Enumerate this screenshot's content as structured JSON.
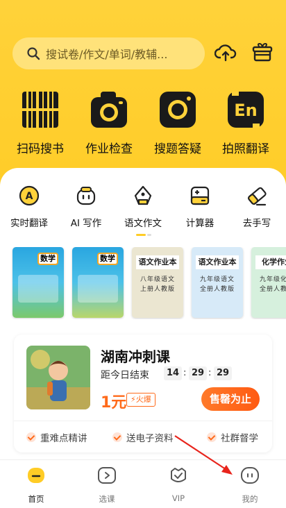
{
  "search": {
    "placeholder": "搜试卷/作文/单词/教辅..."
  },
  "header_icons": [
    "upload-cloud-icon",
    "gift-icon"
  ],
  "features": [
    {
      "label": "扫码搜书",
      "icon": "barcode-icon"
    },
    {
      "label": "作业检查",
      "icon": "camera-icon"
    },
    {
      "label": "搜题答疑",
      "icon": "photo-search-icon"
    },
    {
      "label": "拍照翻译",
      "icon": "translate-en-icon"
    }
  ],
  "tools": [
    {
      "label": "实时翻译",
      "icon": "translate-a-icon"
    },
    {
      "label": "AI 写作",
      "icon": "robot-icon"
    },
    {
      "label": "语文作文",
      "icon": "pen-nib-icon"
    },
    {
      "label": "计算器",
      "icon": "calculator-icon"
    },
    {
      "label": "去手写",
      "icon": "eraser-icon"
    }
  ],
  "books": [
    {
      "badge": "数学",
      "caption": "",
      "color": "#2b9ad8"
    },
    {
      "badge": "数学",
      "caption": "",
      "color": "#2b9ad8"
    },
    {
      "badge": "语文作业本",
      "caption": "八年级语文 上册人教版",
      "color": "#e9e4cf"
    },
    {
      "badge": "语文作业本",
      "caption": "九年级语文 全册人教版",
      "color": "#d9ebf7"
    },
    {
      "badge": "化学作业",
      "caption": "九年级化学 全册人教版",
      "color": "#d8f0df"
    }
  ],
  "promo": {
    "title": "湖南冲刺课",
    "countdown_label": "距今日结束",
    "hours": "14",
    "minutes": "29",
    "seconds": "29",
    "price": "1元",
    "hot_badge": "火爆",
    "cta": "售罄为止",
    "perks": [
      "重难点精讲",
      "送电子资料",
      "社群督学"
    ]
  },
  "tabbar": [
    {
      "label": "首页",
      "icon": "home-icon",
      "active": true
    },
    {
      "label": "选课",
      "icon": "play-course-icon",
      "active": false
    },
    {
      "label": "VIP",
      "icon": "vip-shield-icon",
      "active": false
    },
    {
      "label": "我的",
      "icon": "profile-face-icon",
      "active": false
    }
  ],
  "colors": {
    "brand_yellow": "#ffd23a",
    "accent_orange": "#ff6a1a"
  }
}
